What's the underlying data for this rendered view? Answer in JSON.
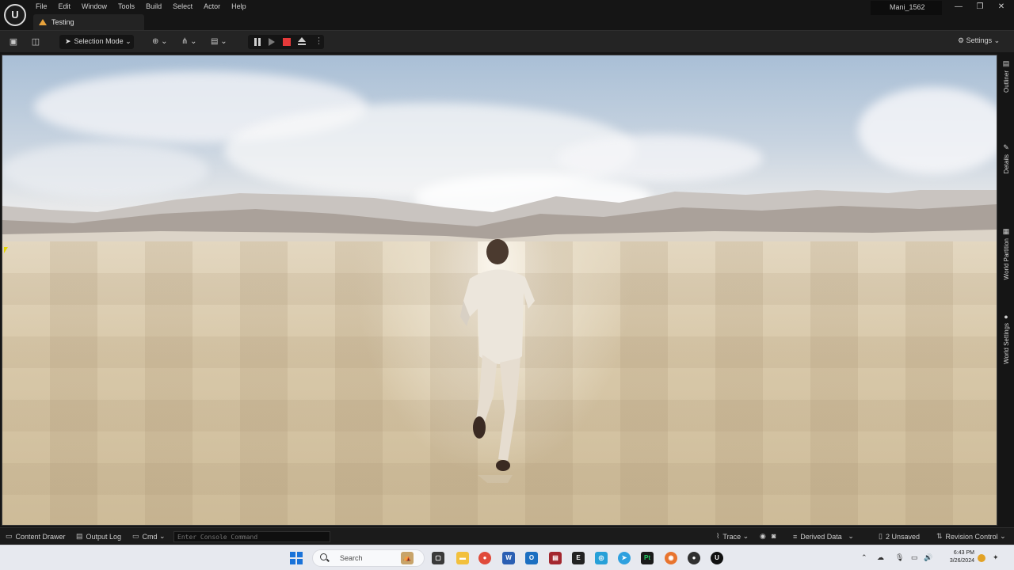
{
  "window": {
    "menu": [
      "File",
      "Edit",
      "Window",
      "Tools",
      "Build",
      "Select",
      "Actor",
      "Help"
    ],
    "tab_title": "Testing",
    "project_name": "Mani_1562",
    "controls": {
      "minimize": "—",
      "maximize": "❐",
      "close": "✕"
    }
  },
  "toolbar": {
    "selection_mode": "Selection Mode",
    "settings": "Settings"
  },
  "side_tabs": [
    "Outliner",
    "Details",
    "World Partition",
    "World Settings"
  ],
  "statusbar": {
    "content_drawer": "Content Drawer",
    "output_log": "Output Log",
    "cmd": "Cmd",
    "console_placeholder": "Enter Console Command",
    "trace": "Trace",
    "derived_data": "Derived Data",
    "unsaved": "2 Unsaved",
    "revision_control": "Revision Control"
  },
  "taskbar": {
    "search_placeholder": "Search",
    "time": "6:43 PM",
    "date": "3/26/2024"
  },
  "colors": {
    "editor_bg": "#151515",
    "toolbar_bg": "#242424",
    "stop_red": "#e63a3a",
    "warning_orange": "#e8a33c",
    "windows_blue": "#1a73d9"
  }
}
